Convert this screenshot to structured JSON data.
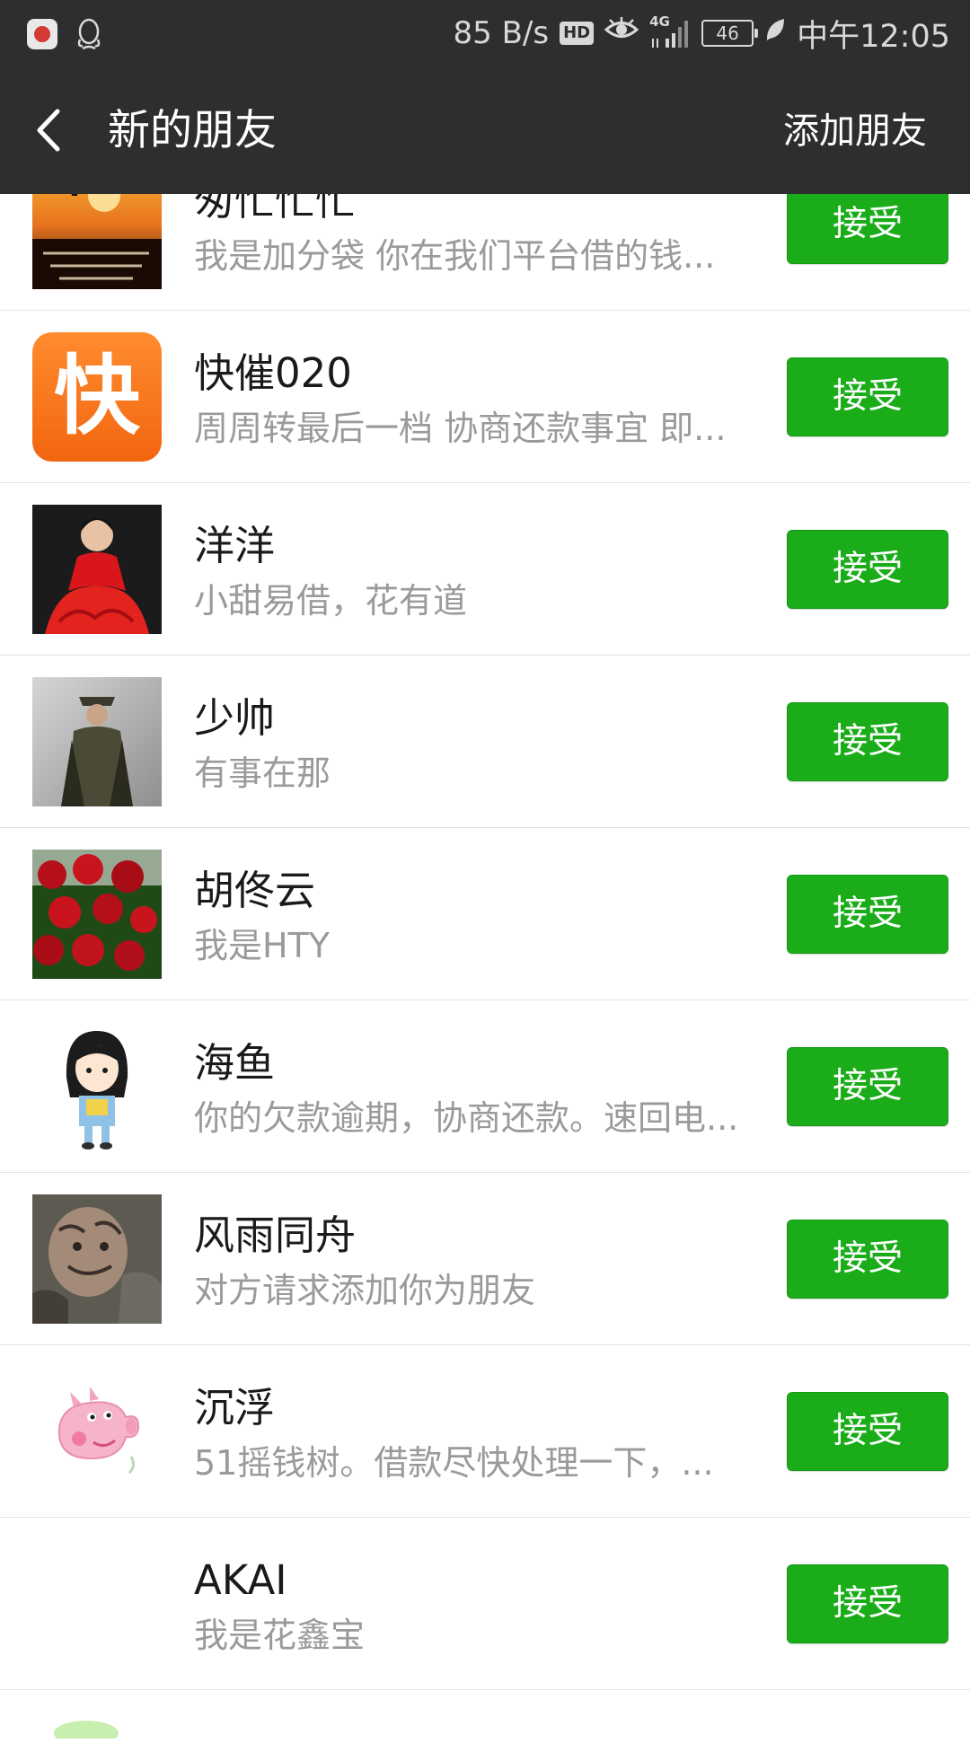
{
  "status_bar": {
    "network_speed": "85 B/s",
    "hd_label": "HD",
    "network_type": "4G",
    "battery": "46",
    "time": "中午12:05",
    "icons": [
      "app-notification-icon",
      "qq-icon",
      "eye-icon",
      "signal-icon",
      "battery-icon",
      "leaf-icon"
    ]
  },
  "header": {
    "back_icon": "chevron-left-icon",
    "title": "新的朋友",
    "add_friend": "添加朋友"
  },
  "accept_label": "接受",
  "requests": [
    {
      "name": "匆忙忙忙",
      "message": "我是加分袋 你在我们平台借的钱...",
      "avatar": "sunset-photo"
    },
    {
      "name": "快催020",
      "message": "周周转最后一档 协商还款事宜 即...",
      "avatar": "orange-kuai-logo",
      "avatar_text": "快"
    },
    {
      "name": "洋洋",
      "message": "小甜易借，花有道",
      "avatar": "woman-red-dress-photo"
    },
    {
      "name": "少帅",
      "message": "有事在那",
      "avatar": "military-officer-photo"
    },
    {
      "name": "胡佟云",
      "message": "我是HTY",
      "avatar": "red-roses-photo"
    },
    {
      "name": "海鱼",
      "message": "你的欠款逾期，协商还款。速回电...",
      "avatar": "cartoon-girl"
    },
    {
      "name": "风雨同舟",
      "message": "对方请求添加你为朋友",
      "avatar": "tattooed-face-photo"
    },
    {
      "name": "沉浮",
      "message": "51摇钱树。借款尽快处理一下，...",
      "avatar": "peppa-pig"
    },
    {
      "name": "AKAI",
      "message": "我是花鑫宝",
      "avatar": "blank"
    }
  ],
  "colors": {
    "header_bg": "#2e2e2e",
    "accept_green": "#1aad19",
    "name_text": "#1a1a1a",
    "message_text": "#9a9a9a"
  }
}
